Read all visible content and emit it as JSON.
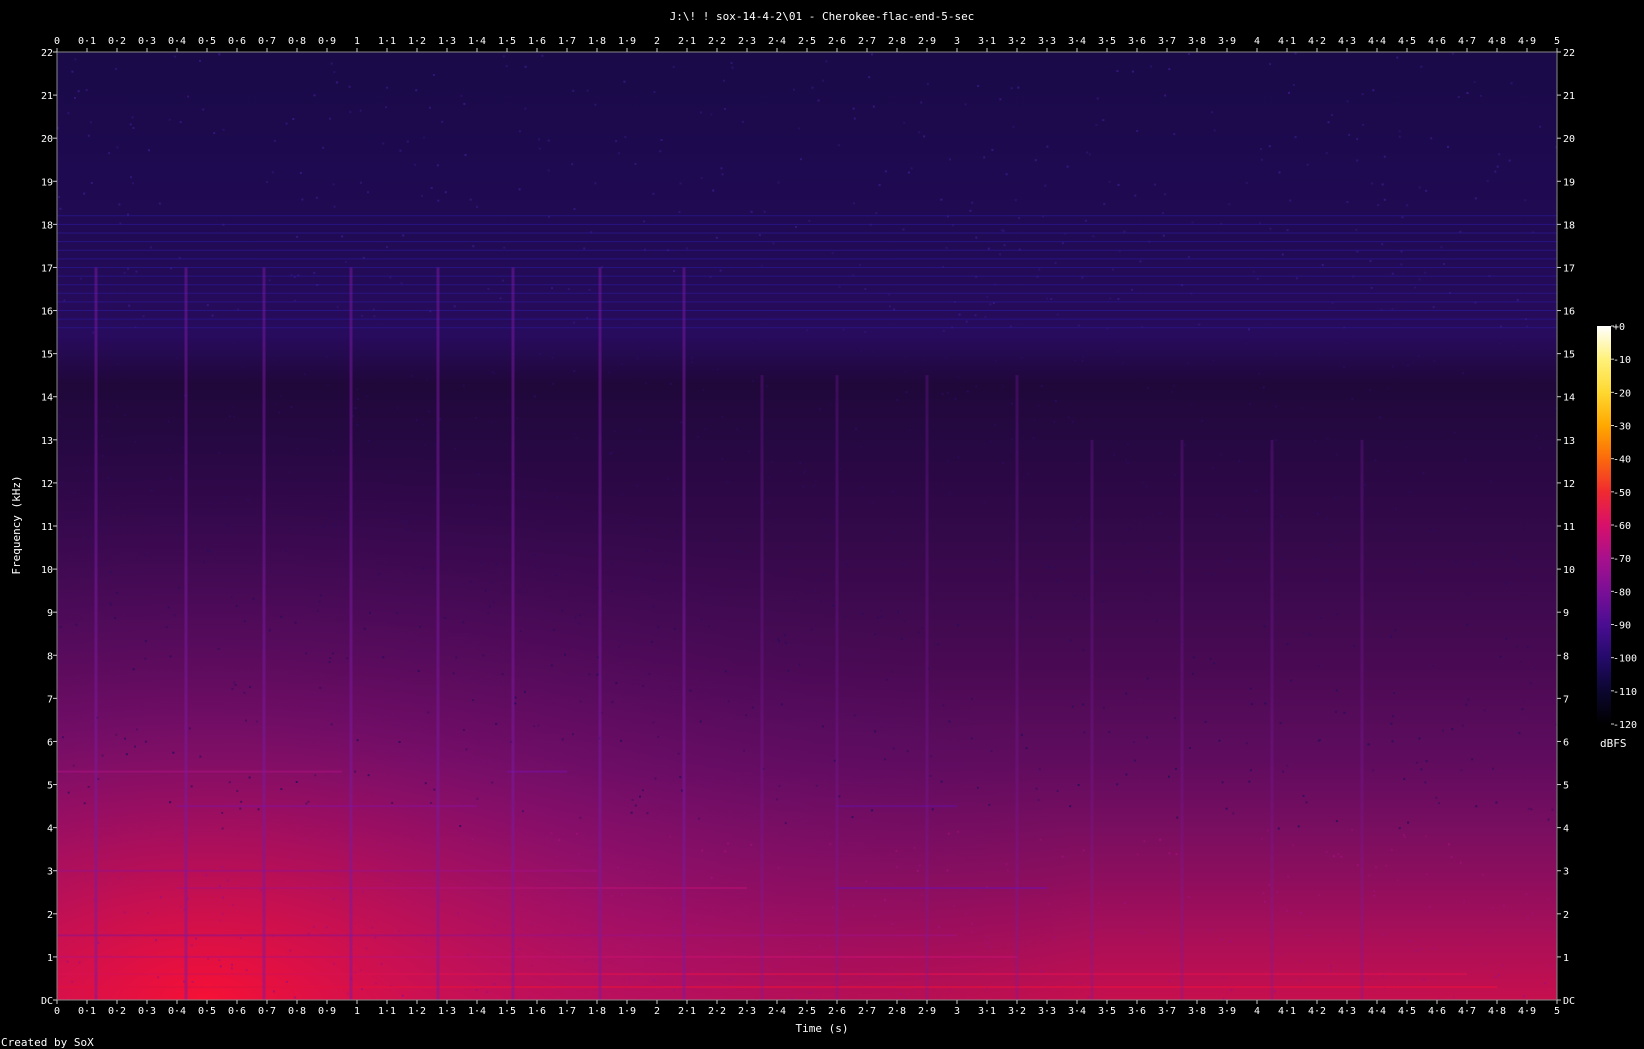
{
  "title": "J:\\! ! sox-14-4-2\\01 - Cherokee-flac-end-5-sec",
  "credit": "Created by SoX",
  "chart_data": {
    "type": "heatmap",
    "xlabel": "Time (s)",
    "ylabel": "Frequency (kHz)",
    "xlim": [
      0,
      5
    ],
    "ylim": [
      0,
      22
    ],
    "x_ticks": [
      "0",
      "0·1",
      "0·2",
      "0·3",
      "0·4",
      "0·5",
      "0·6",
      "0·7",
      "0·8",
      "0·9",
      "1",
      "1·1",
      "1·2",
      "1·3",
      "1·4",
      "1·5",
      "1·6",
      "1·7",
      "1·8",
      "1·9",
      "2",
      "2·1",
      "2·2",
      "2·3",
      "2·4",
      "2·5",
      "2·6",
      "2·7",
      "2·8",
      "2·9",
      "3",
      "3·1",
      "3·2",
      "3·3",
      "3·4",
      "3·5",
      "3·6",
      "3·7",
      "3·8",
      "3·9",
      "4",
      "4·1",
      "4·2",
      "4·3",
      "4·4",
      "4·5",
      "4·6",
      "4·7",
      "4·8",
      "4·9",
      "5"
    ],
    "y_ticks": [
      "DC",
      "1",
      "2",
      "3",
      "4",
      "5",
      "6",
      "7",
      "8",
      "9",
      "10",
      "11",
      "12",
      "13",
      "14",
      "15",
      "16",
      "17",
      "18",
      "19",
      "20",
      "21",
      "22"
    ],
    "colorbar": {
      "label": "dBFS",
      "range": [
        -120,
        0
      ],
      "ticks": [
        "+0",
        "-10",
        "-20",
        "-30",
        "-40",
        "-50",
        "-60",
        "-70",
        "-80",
        "-90",
        "-100",
        "-110",
        "-120"
      ],
      "colors": [
        "#000000",
        "#0c0730",
        "#240a6a",
        "#4a0d92",
        "#7a0f96",
        "#a8108c",
        "#d8106a",
        "#f02a30",
        "#fb6a0c",
        "#ffa800",
        "#ffd830",
        "#fff27a",
        "#ffffff"
      ]
    },
    "transients_s": [
      0.13,
      0.43,
      0.69,
      0.98,
      1.27,
      1.52,
      1.81,
      2.09,
      2.35,
      2.6,
      2.9,
      3.2,
      3.45,
      3.75,
      4.05,
      4.35
    ],
    "grid": false,
    "legend": "colorbar right"
  }
}
